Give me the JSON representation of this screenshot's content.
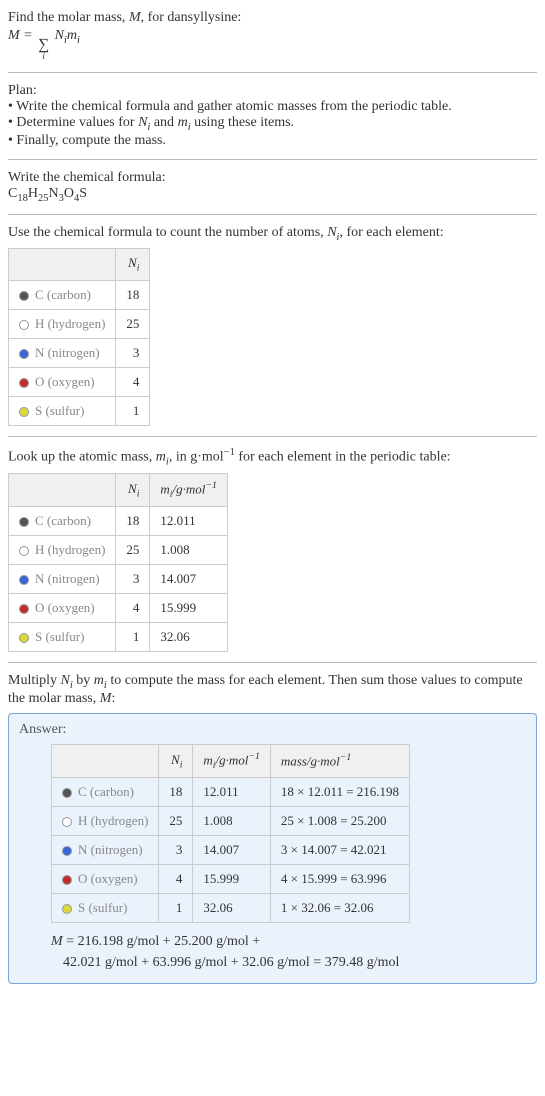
{
  "intro": {
    "line1_pre": "Find the molar mass, ",
    "line1_M": "M",
    "line1_post": ", for dansyllysine:",
    "eq_lhs": "M = ",
    "eq_rhs": " N",
    "eq_rhs2": "m",
    "idx_var": "i"
  },
  "plan": {
    "heading": "Plan:",
    "b1_pre": "• Write the chemical formula and gather atomic masses from the periodic table.",
    "b2": "• Determine values for ",
    "b2_N": "N",
    "b2_and": " and ",
    "b2_m": "m",
    "b2_post": " using these items.",
    "b3": "• Finally, compute the mass."
  },
  "formula": {
    "heading": "Write the chemical formula:",
    "C": "C",
    "Cn": "18",
    "H": "H",
    "Hn": "25",
    "N": "N",
    "Nn": "3",
    "O": "O",
    "On": "4",
    "S": "S"
  },
  "count": {
    "heading_pre": "Use the chemical formula to count the number of atoms, ",
    "heading_N": "N",
    "heading_post": ", for each element:",
    "col_N": "N",
    "col_idx": "i",
    "elements": [
      {
        "name": "C (carbon)",
        "sw": "sw-c",
        "n": "18"
      },
      {
        "name": "H (hydrogen)",
        "sw": "sw-h",
        "n": "25"
      },
      {
        "name": "N (nitrogen)",
        "sw": "sw-n",
        "n": "3"
      },
      {
        "name": "O (oxygen)",
        "sw": "sw-o",
        "n": "4"
      },
      {
        "name": "S (sulfur)",
        "sw": "sw-s",
        "n": "1"
      }
    ]
  },
  "masses": {
    "heading_pre": "Look up the atomic mass, ",
    "heading_m": "m",
    "heading_mid": ", in g·mol",
    "heading_exp": "−1",
    "heading_post": " for each element in the periodic table:",
    "col_m_pre": "m",
    "col_m_mid": "/g·mol",
    "rows": [
      {
        "name": "C (carbon)",
        "sw": "sw-c",
        "n": "18",
        "m": "12.011"
      },
      {
        "name": "H (hydrogen)",
        "sw": "sw-h",
        "n": "25",
        "m": "1.008"
      },
      {
        "name": "N (nitrogen)",
        "sw": "sw-n",
        "n": "3",
        "m": "14.007"
      },
      {
        "name": "O (oxygen)",
        "sw": "sw-o",
        "n": "4",
        "m": "15.999"
      },
      {
        "name": "S (sulfur)",
        "sw": "sw-s",
        "n": "1",
        "m": "32.06"
      }
    ]
  },
  "multiply": {
    "pre": "Multiply ",
    "N": "N",
    "by": " by ",
    "m": "m",
    "post": " to compute the mass for each element. Then sum those values to compute the molar mass, ",
    "M": "M",
    "end": ":"
  },
  "answer": {
    "label": "Answer:",
    "col_mass": "mass/g·mol",
    "rows": [
      {
        "name": "C (carbon)",
        "sw": "sw-c",
        "n": "18",
        "m": "12.011",
        "mass": "18 × 12.011 = 216.198"
      },
      {
        "name": "H (hydrogen)",
        "sw": "sw-h",
        "n": "25",
        "m": "1.008",
        "mass": "25 × 1.008 = 25.200"
      },
      {
        "name": "N (nitrogen)",
        "sw": "sw-n",
        "n": "3",
        "m": "14.007",
        "mass": "3 × 14.007 = 42.021"
      },
      {
        "name": "O (oxygen)",
        "sw": "sw-o",
        "n": "4",
        "m": "15.999",
        "mass": "4 × 15.999 = 63.996"
      },
      {
        "name": "S (sulfur)",
        "sw": "sw-s",
        "n": "1",
        "m": "32.06",
        "mass": "1 × 32.06 = 32.06"
      }
    ],
    "eq1_pre": "M",
    "eq1": " = 216.198 g/mol + 25.200 g/mol +",
    "eq2": "42.021 g/mol + 63.996 g/mol + 32.06 g/mol = 379.48 g/mol"
  }
}
